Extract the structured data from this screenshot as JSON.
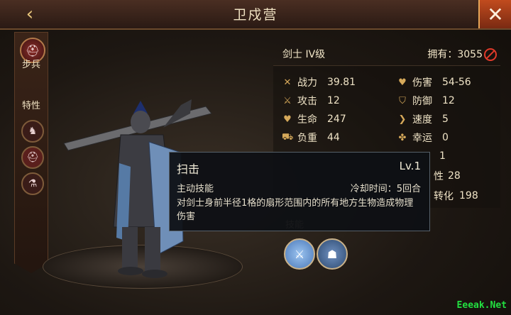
{
  "header": {
    "title": "卫戍营",
    "back_icon": "chevron-left-icon",
    "close_icon": "close-icon"
  },
  "sidebar": {
    "unit_type": "步兵",
    "traits_title": "特性",
    "traits": [
      "horse-silhouette-icon",
      "helmet-icon",
      "flask-icon"
    ]
  },
  "unit": {
    "name": "剑士 IV级",
    "owned": "拥有：3055"
  },
  "stats": [
    {
      "icon": "crossed-swords-icon",
      "label": "战力",
      "value": "39.81"
    },
    {
      "icon": "heart-sword-icon",
      "label": "伤害",
      "value": "54-56"
    },
    {
      "icon": "sword-icon",
      "label": "攻击",
      "value": "12"
    },
    {
      "icon": "shield-icon",
      "label": "防御",
      "value": "12"
    },
    {
      "icon": "heart-icon",
      "label": "生命",
      "value": "247"
    },
    {
      "icon": "boot-icon",
      "label": "速度",
      "value": "5"
    },
    {
      "icon": "cart-icon",
      "label": "负重",
      "value": "44"
    },
    {
      "icon": "clover-icon",
      "label": "幸运",
      "value": "0"
    }
  ],
  "partial_stats": [
    "1",
    "28",
    "198"
  ],
  "partial_labels": [
    "性",
    "转化"
  ],
  "skills_title": "技能",
  "skills": [
    {
      "name": "sweep-skill-icon",
      "color": "#4a78b8"
    },
    {
      "name": "warrior-skill-icon",
      "color": "#2d4a70"
    }
  ],
  "tooltip": {
    "name": "扫击",
    "level": "Lv.1",
    "type": "主动技能",
    "cooldown": "冷却时间：5回合",
    "description": "对剑士身前半径1格的扇形范围内的所有地方生物造成物理伤害"
  },
  "watermark": "Eeeak.Net"
}
